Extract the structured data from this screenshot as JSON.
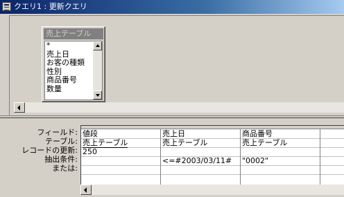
{
  "window": {
    "title": "クエリ1 : 更新クエリ"
  },
  "field_list": {
    "title": "売上テーブル",
    "items": [
      "*",
      "売上日",
      "お客の種類",
      "性別",
      "商品番号",
      "数量"
    ]
  },
  "design_grid": {
    "row_labels": [
      "フィールド:",
      "テーブル:",
      "レコードの更新:",
      "抽出条件:",
      "または:"
    ],
    "columns": [
      {
        "field": "値段",
        "table": "売上テーブル",
        "update": "250",
        "criteria": "",
        "or": ""
      },
      {
        "field": "売上日",
        "table": "売上テーブル",
        "update": "",
        "criteria": "<=#2003/03/11#",
        "or": ""
      },
      {
        "field": "商品番号",
        "table": "売上テーブル",
        "update": "",
        "criteria": "\"0002\"",
        "or": ""
      },
      {
        "field": "",
        "table": "",
        "update": "",
        "criteria": "",
        "or": ""
      }
    ]
  }
}
